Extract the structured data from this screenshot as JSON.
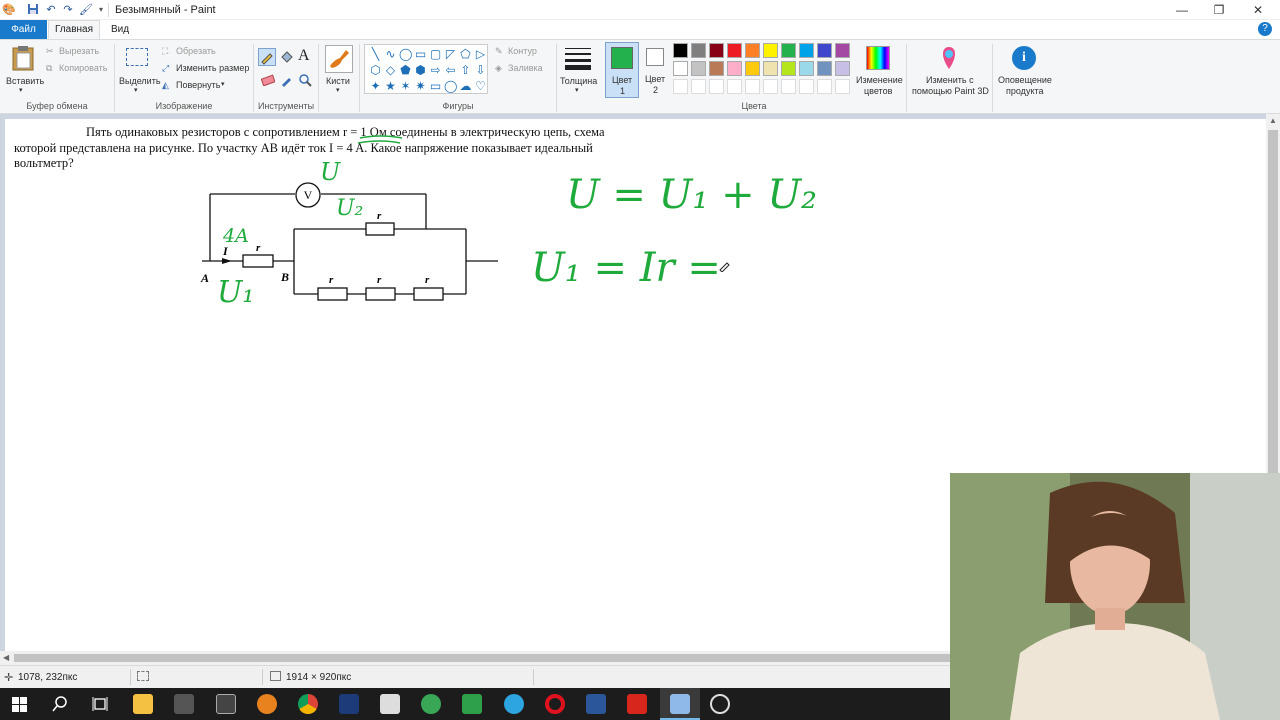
{
  "titlebar": {
    "title": "Безымянный - Paint",
    "minimize_glyph": "—",
    "maximize_glyph": "❐",
    "close_glyph": "✕"
  },
  "tabs": {
    "file": "Файл",
    "home": "Главная",
    "view": "Вид",
    "help_glyph": "?"
  },
  "ribbon": {
    "clipboard": {
      "paste": "Вставить",
      "cut": "Вырезать",
      "copy": "Копировать",
      "label": "Буфер обмена"
    },
    "image": {
      "select": "Выделить",
      "crop": "Обрезать",
      "resize": "Изменить размер",
      "rotate": "Повернуть",
      "label": "Изображение"
    },
    "tools": {
      "label": "Инструменты",
      "text_glyph": "A"
    },
    "brushes": {
      "label": "Кисти"
    },
    "shapes": {
      "outline": "Контур",
      "fill": "Заливка",
      "label": "Фигуры",
      "glyphs": [
        "╲",
        "∿",
        "◯",
        "▭",
        "▢",
        "◸",
        "⬠",
        "▷",
        "⬡",
        "◇",
        "⬟",
        "⬢",
        "⇨",
        "⇦",
        "⇧",
        "⇩",
        "✦",
        "★",
        "✶",
        "✷",
        "▭",
        "◯",
        "☁",
        "♡"
      ]
    },
    "size": {
      "label": "Толщина"
    },
    "color1": {
      "label_line1": "Цвет",
      "label_line2": "1",
      "color": "#22b14c"
    },
    "color2": {
      "label_line1": "Цвет",
      "label_line2": "2",
      "color": "#ffffff"
    },
    "colors": {
      "label": "Цвета",
      "row1": [
        "#000000",
        "#7f7f7f",
        "#880015",
        "#ed1c24",
        "#ff7f27",
        "#fff200",
        "#22b14c",
        "#00a2e8",
        "#3f48cc",
        "#a349a4"
      ],
      "row2": [
        "#ffffff",
        "#c3c3c3",
        "#b97a57",
        "#ffaec9",
        "#ffc90e",
        "#efe4b0",
        "#b5e61d",
        "#99d9ea",
        "#7092be",
        "#c8bfe7"
      ],
      "row3": [
        "#ffffff",
        "#ffffff",
        "#ffffff",
        "#ffffff",
        "#ffffff",
        "#ffffff",
        "#ffffff",
        "#ffffff",
        "#ffffff",
        "#ffffff"
      ]
    },
    "edit_colors": {
      "line1": "Изменение",
      "line2": "цветов"
    },
    "paint3d": {
      "line1": "Изменить с",
      "line2": "помощью Paint 3D"
    },
    "notify": {
      "line1": "Оповещение",
      "line2": "продукта"
    }
  },
  "problem": {
    "part1": "Пять одинаковых резисторов с сопротивлением",
    "r_value": "r = 1 Ом",
    "part2": "соединены в электрическую цепь, схема которой представлена на рисунке. По участку AB идёт ток",
    "i_value": "I = 4 A",
    "part3": ". Какое напряжение показывает идеальный вольтметр?"
  },
  "circuit": {
    "voltmeter": "V",
    "point_a": "A",
    "point_b": "B",
    "current": "I",
    "resistor": "r"
  },
  "handwriting": {
    "u_top": "U",
    "u2_label": "U₂",
    "current_4a": "4A",
    "u1_label": "U₁",
    "eq1": "U = U₁ + U₂",
    "eq2": "U₁ = Ir =",
    "ink_color": "#1faa3c"
  },
  "status": {
    "cursor_pos": "1078, 232пкс",
    "canvas_size": "1914 × 920пкс"
  },
  "taskbar": {
    "apps": [
      "windows-start",
      "search",
      "task-view",
      "file-explorer",
      "tools-app",
      "calculator",
      "cat-app",
      "chrome",
      "dev-app",
      "adobe-app",
      "green-app-1",
      "green-app-2",
      "telegram",
      "opera",
      "word",
      "acrobat",
      "paint",
      "obs"
    ]
  }
}
